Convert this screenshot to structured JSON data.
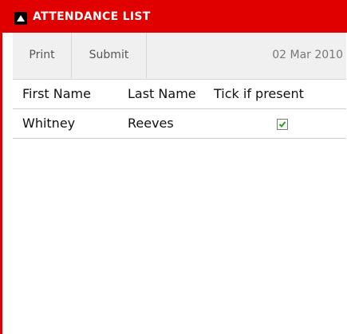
{
  "window": {
    "title": "ATTENDANCE LIST",
    "accent_color": "#e10000",
    "collapse_icon": "triangle-up-icon"
  },
  "toolbar": {
    "print_label": "Print",
    "submit_label": "Submit",
    "date": "02 Mar 2010"
  },
  "table": {
    "columns": [
      "First Name",
      "Last Name",
      "Tick if present"
    ],
    "rows": [
      {
        "first_name": "Whitney",
        "last_name": "Reeves",
        "present": true
      }
    ]
  }
}
